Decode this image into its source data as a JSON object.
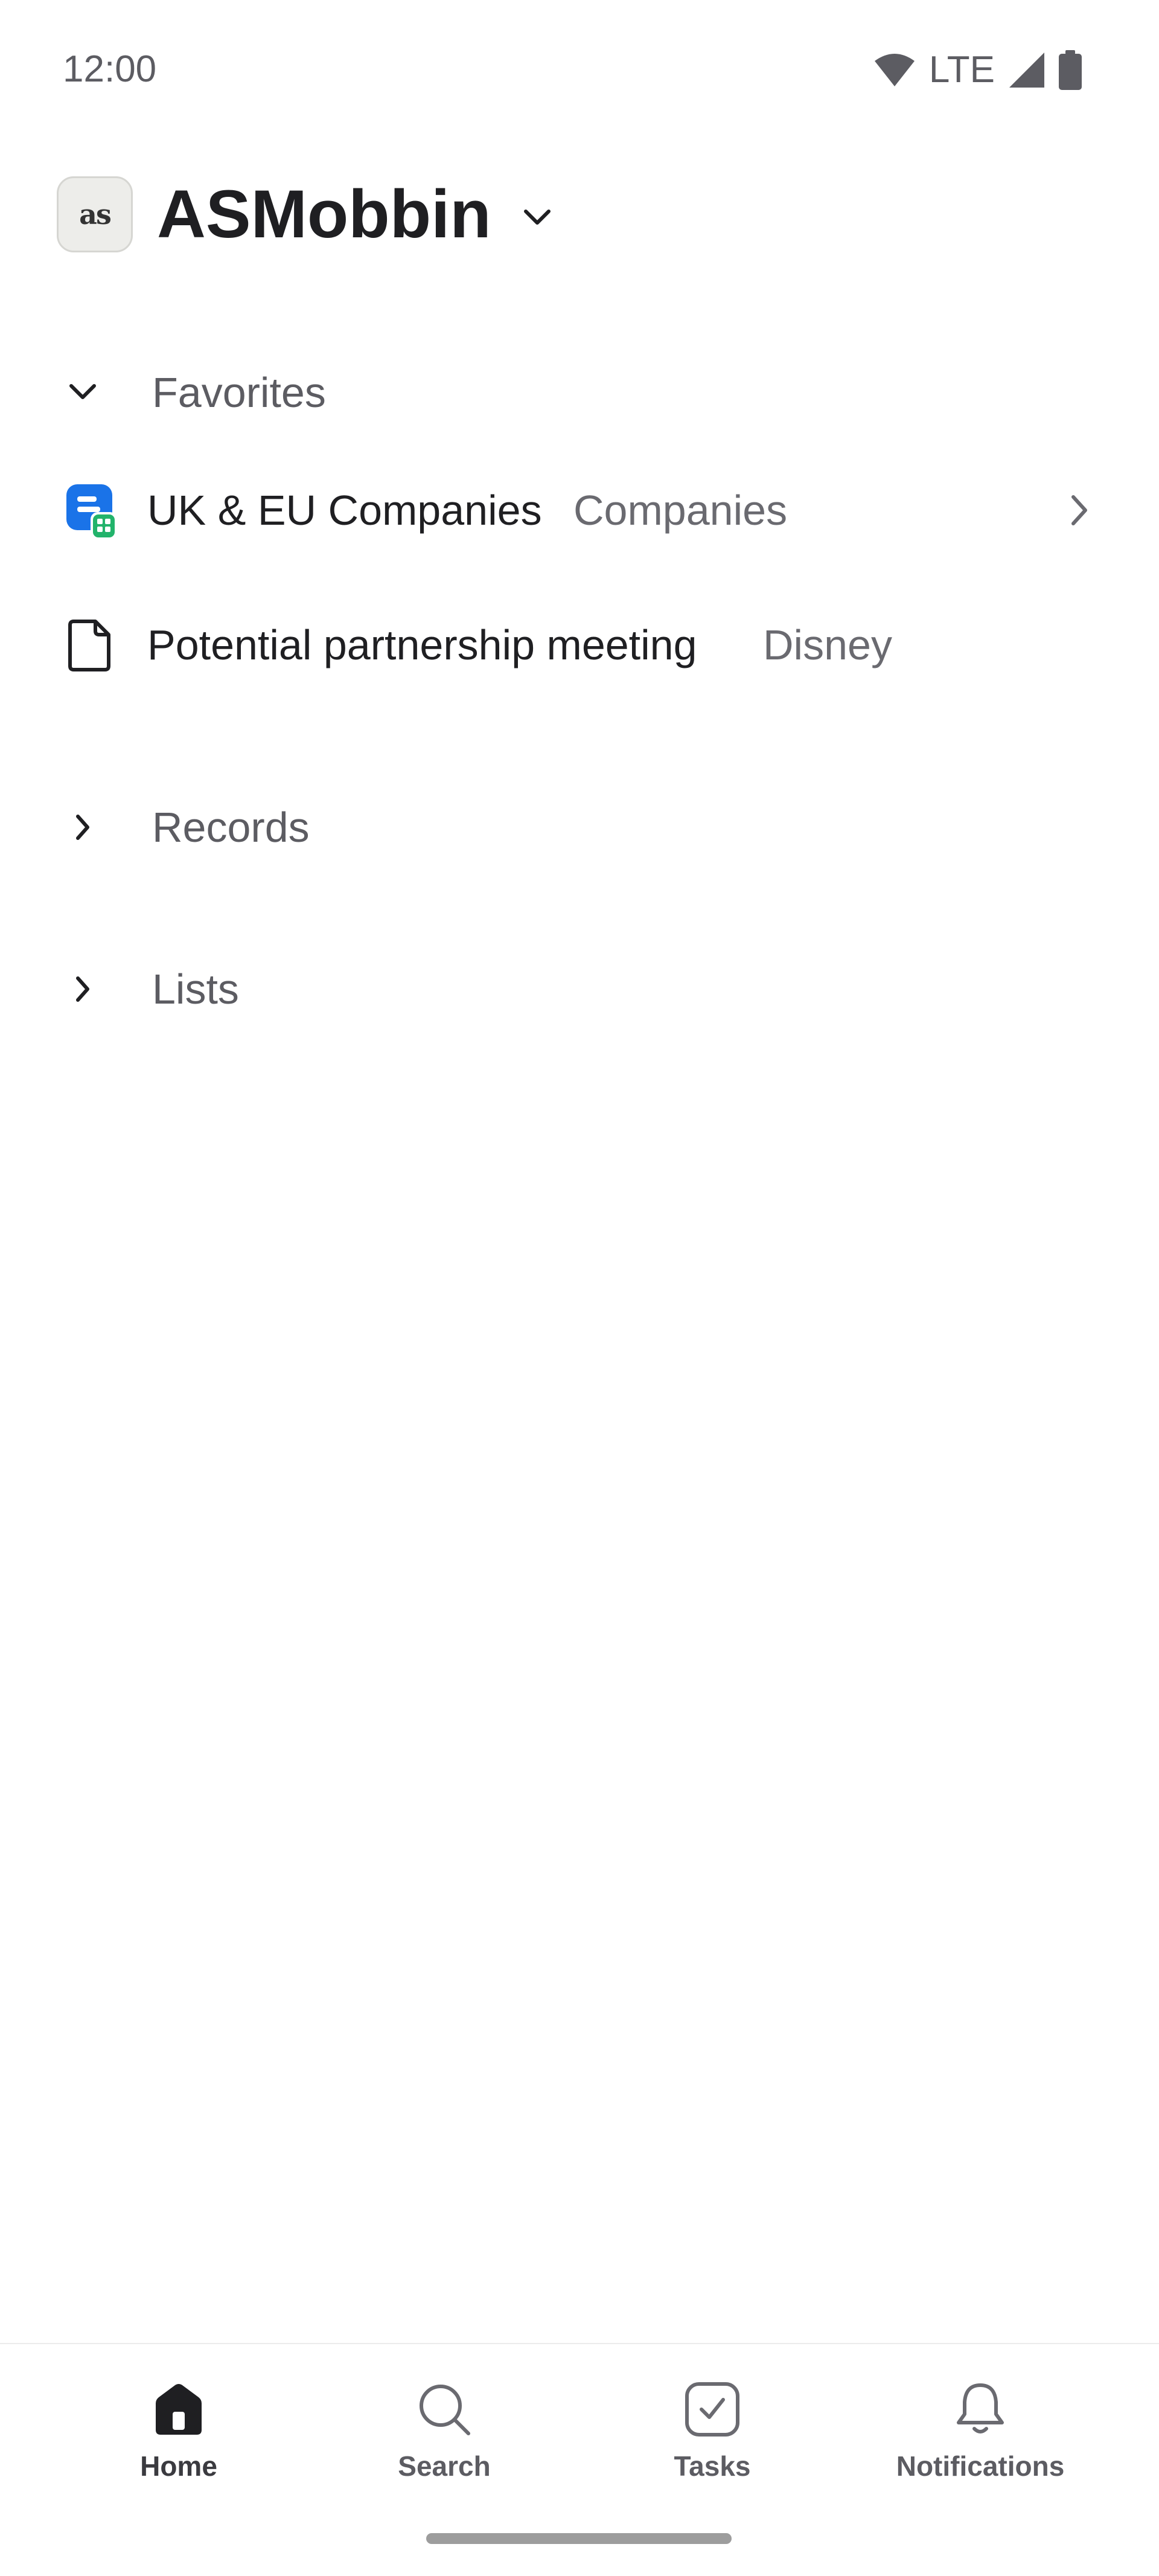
{
  "status_bar": {
    "time": "12:00",
    "network": "LTE",
    "icons": [
      "wifi-icon",
      "cell-signal-icon",
      "battery-icon"
    ]
  },
  "workspace": {
    "avatar_text": "as",
    "name": "ASMobbin",
    "icon": "chevron-down-icon"
  },
  "sections": {
    "favorites": {
      "label": "Favorites",
      "expanded": true,
      "items": [
        {
          "title": "UK & EU Companies",
          "subtitle": "Companies",
          "icon": "companies-list-icon",
          "has_chevron": true
        },
        {
          "title": "Potential partnership meeting",
          "subtitle": "Disney",
          "icon": "note-icon",
          "has_chevron": false
        }
      ]
    },
    "records": {
      "label": "Records",
      "expanded": false
    },
    "lists": {
      "label": "Lists",
      "expanded": false
    }
  },
  "bottom_nav": {
    "items": [
      {
        "label": "Home",
        "icon": "home-icon",
        "active": true
      },
      {
        "label": "Search",
        "icon": "search-icon",
        "active": false
      },
      {
        "label": "Tasks",
        "icon": "tasks-icon",
        "active": false
      },
      {
        "label": "Notifications",
        "icon": "bell-icon",
        "active": false
      }
    ]
  },
  "colors": {
    "text_primary": "#1f1f22",
    "text_secondary": "#5c5c62",
    "companies_icon_blue": "#1a73e8",
    "companies_icon_green": "#22b36b"
  }
}
